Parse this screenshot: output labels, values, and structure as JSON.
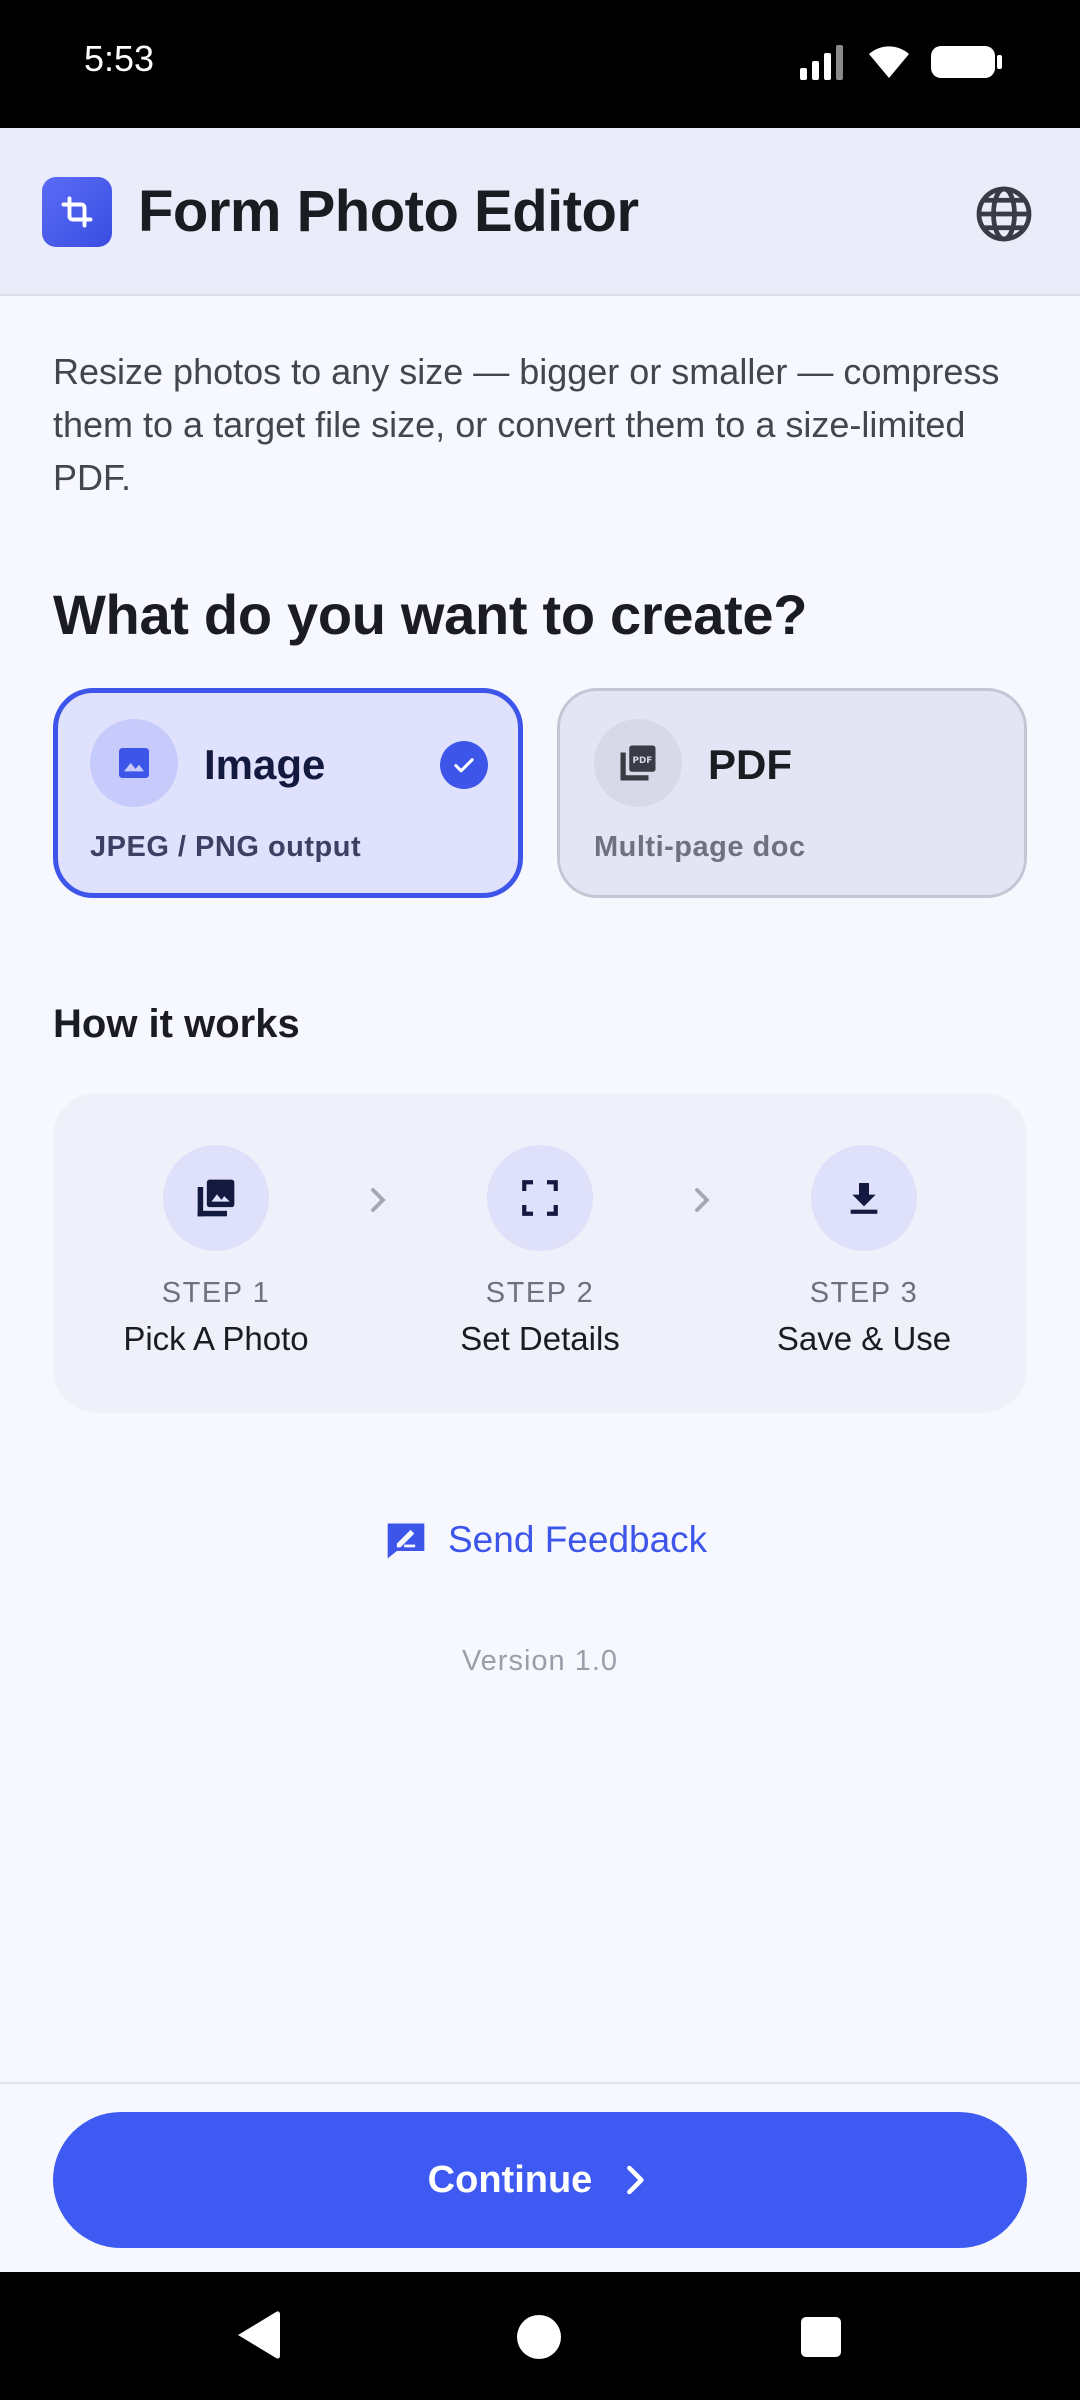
{
  "status_bar": {
    "time": "5:53"
  },
  "app_bar": {
    "title": "Form Photo Editor"
  },
  "intro_text": "Resize photos to any size — bigger or smaller — compress them to a target file size, or convert them to a size-limited PDF.",
  "question": "What do you want to create?",
  "options": [
    {
      "title": "Image",
      "subtitle": "JPEG / PNG output",
      "selected": true
    },
    {
      "title": "PDF",
      "subtitle": "Multi-page doc",
      "selected": false
    }
  ],
  "how_it_works": {
    "title": "How it works",
    "steps": [
      {
        "number": "STEP 1",
        "label": "Pick A Photo"
      },
      {
        "number": "STEP 2",
        "label": "Set Details"
      },
      {
        "number": "STEP 3",
        "label": "Save & Use"
      }
    ]
  },
  "feedback_label": "Send Feedback",
  "version": "Version 1.0",
  "continue_label": "Continue",
  "colors": {
    "accent": "#3f5af2",
    "selected_card_bg": "#e0e2fd",
    "app_bar_bg": "#ebecf9"
  }
}
